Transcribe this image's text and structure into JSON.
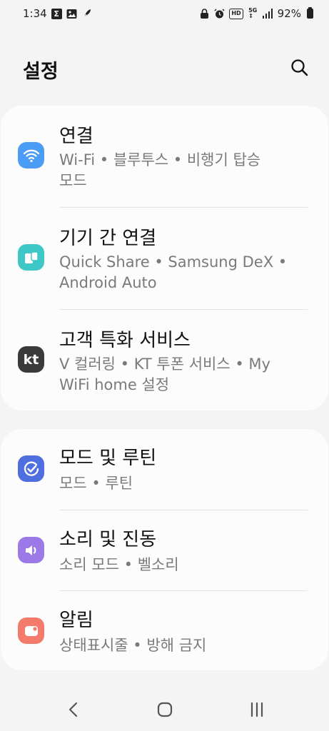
{
  "status_bar": {
    "time": "1:34",
    "battery_percent": "92%",
    "left_icons": [
      "sigma-icon",
      "gallery-icon",
      "feather-icon"
    ],
    "right_icons": [
      "alarm-lock-icon",
      "alarm-icon",
      "hd-icon",
      "5g-icon",
      "signal-icon",
      "battery-icon"
    ]
  },
  "header": {
    "title": "설정"
  },
  "groups": [
    {
      "items": [
        {
          "title": "연결",
          "subtitle_line1": "Wi-Fi  •  블루투스  •  비행기 탑승",
          "subtitle_line2": "모드",
          "icon": "wifi-icon",
          "icon_color": "#4b9cf5"
        },
        {
          "title": "기기 간 연결",
          "subtitle_line1": "Quick Share  •  Samsung DeX  •",
          "subtitle_line2": "Android Auto",
          "icon": "devices-icon",
          "icon_color": "#3dc7c7"
        },
        {
          "title": "고객 특화 서비스",
          "subtitle_line1": "V 컬러링  •  KT 투폰 서비스  •  My",
          "subtitle_line2": "WiFi home 설정",
          "icon": "kt-icon",
          "icon_text": "kt",
          "icon_color": "#3a3a3a"
        }
      ]
    },
    {
      "items": [
        {
          "title": "모드 및 루틴",
          "subtitle_line1": "모드  •  루틴",
          "icon": "routine-check-icon",
          "icon_color": "#4f6fe0"
        },
        {
          "title": "소리 및 진동",
          "subtitle_line1": "소리 모드  •  벨소리",
          "icon": "speaker-icon",
          "icon_color": "#9b7ae8"
        },
        {
          "title": "알림",
          "subtitle_line1": "상태표시줄  •  방해 금지",
          "icon": "notification-icon",
          "icon_color": "#f47a6b"
        }
      ]
    }
  ],
  "nav_bar": {
    "buttons": [
      "back-icon",
      "home-icon",
      "recents-icon"
    ]
  }
}
